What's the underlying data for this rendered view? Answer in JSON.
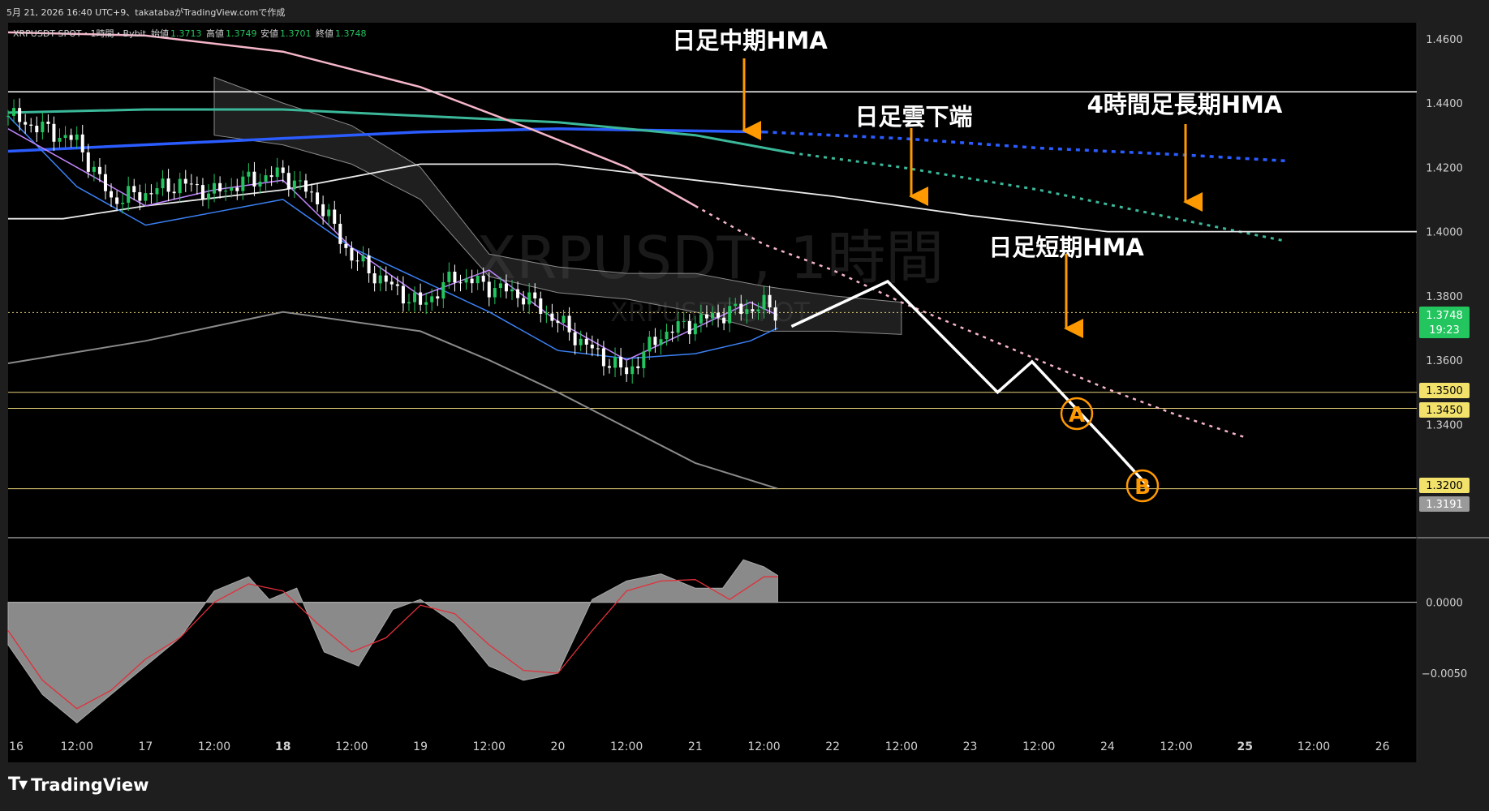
{
  "header": {
    "caption": "5月 21, 2026 16:40 UTC+9、takatabaがTradingView.comで作成",
    "symbol_line": "XRPUSDT SPOT・1時間・Bybit",
    "ohlc": [
      {
        "label": "始値",
        "value": "1.3713"
      },
      {
        "label": "高値",
        "value": "1.3749"
      },
      {
        "label": "安値",
        "value": "1.3701"
      },
      {
        "label": "終値",
        "value": "1.3748"
      }
    ]
  },
  "watermark": {
    "main": "XRPUSDT, 1時間",
    "sub": "XRPUSDT SPOT"
  },
  "annotations": {
    "daily_mid_hma": "日足中期HMA",
    "daily_cloud_lower": "日足雲下端",
    "h4_long_hma": "4時間足長期HMA",
    "daily_short_hma": "日足短期HMA",
    "point_a": "A",
    "point_b": "B"
  },
  "price_labels": {
    "current_price": "1.3748",
    "countdown": "19:23",
    "level_1": "1.3500",
    "level_2": "1.3450",
    "level_3": "1.3200",
    "level_4": "1.3191"
  },
  "footer": {
    "brand": "TradingView"
  },
  "colors": {
    "background": "#000000",
    "panel": "#1e1e1e",
    "up_candle": "#22c55e",
    "down_candle": "#ffffff",
    "mid_hma": "#2a5cff",
    "teal_ma": "#3bb89a",
    "pink_ma": "#f4b5c8",
    "level_line": "#e8d27a",
    "current_price_bg": "#22c55e",
    "arrow": "#ff9900",
    "osc_fill": "#8a8a8a",
    "signal": "#e0303a"
  },
  "chart_data": [
    {
      "type": "line",
      "title": "XRPUSDT SPOT・1時間・Bybit",
      "xlabel": "",
      "ylabel": "",
      "x_ticks": [
        "16",
        "12:00",
        "17",
        "12:00",
        "18",
        "12:00",
        "19",
        "12:00",
        "20",
        "12:00",
        "21",
        "12:00",
        "22",
        "12:00",
        "23",
        "12:00",
        "24",
        "12:00",
        "25",
        "12:00",
        "26"
      ],
      "x_tick_days": [
        16,
        16.5,
        17,
        17.5,
        18,
        18.5,
        19,
        19.5,
        20,
        20.5,
        21,
        21.5,
        22,
        22.5,
        23,
        23.5,
        24,
        24.5,
        25,
        25.5,
        26
      ],
      "xlim": [
        16,
        26.25
      ],
      "y_ticks": [
        "1.4600",
        "1.4400",
        "1.4200",
        "1.4000",
        "1.3800",
        "1.3600",
        "1.3400"
      ],
      "ylim": [
        1.305,
        1.465
      ],
      "horizontal_levels": [
        1.35,
        1.345,
        1.32
      ],
      "current_price": 1.3748,
      "candles": {
        "x": [
          16.0,
          16.25,
          16.5,
          16.75,
          17.0,
          17.25,
          17.5,
          17.75,
          18.0,
          18.25,
          18.5,
          18.75,
          19.0,
          19.25,
          19.5,
          19.75,
          20.0,
          20.25,
          20.5,
          20.75,
          21.0,
          21.25,
          21.5,
          21.6
        ],
        "close": [
          1.436,
          1.432,
          1.428,
          1.41,
          1.412,
          1.415,
          1.412,
          1.416,
          1.418,
          1.41,
          1.392,
          1.384,
          1.377,
          1.386,
          1.383,
          1.38,
          1.372,
          1.363,
          1.356,
          1.368,
          1.372,
          1.375,
          1.377,
          1.3748
        ]
      },
      "series": [
        {
          "name": "",
          "x": [
            16.0,
            17.5,
            19.0,
            20.0,
            21.5,
            22.5,
            23.5,
            24.5,
            25.3
          ],
          "y": [
            1.425,
            1.428,
            1.431,
            1.432,
            1.431,
            1.429,
            1.426,
            1.424,
            1.422
          ]
        },
        {
          "name": "",
          "x": [
            16.0,
            17.0,
            18.0,
            19.0,
            20.0,
            21.0,
            21.7,
            22.5,
            23.5,
            24.5,
            25.3
          ],
          "y": [
            1.437,
            1.438,
            1.438,
            1.436,
            1.434,
            1.43,
            1.4245,
            1.42,
            1.413,
            1.404,
            1.397
          ]
        },
        {
          "name": "",
          "x": [
            16.0,
            17.0,
            18.0,
            19.0,
            19.8,
            20.5,
            21.0,
            21.5,
            22.0,
            22.5,
            23.0,
            23.5,
            24.0,
            24.5,
            25.0
          ],
          "y": [
            1.462,
            1.461,
            1.456,
            1.445,
            1.432,
            1.42,
            1.408,
            1.396,
            1.388,
            1.378,
            1.369,
            1.36,
            1.351,
            1.343,
            1.336
          ]
        },
        {
          "name": "",
          "x": [
            16.0,
            26.25
          ],
          "y": [
            1.4435,
            1.4435
          ]
        },
        {
          "name": "",
          "x": [
            16.0,
            16.4,
            17.0,
            18.0,
            19.0,
            20.0,
            21.0,
            22.0,
            23.0,
            24.0,
            25.0,
            26.25
          ],
          "y": [
            1.404,
            1.404,
            1.408,
            1.413,
            1.421,
            1.421,
            1.416,
            1.411,
            1.405,
            1.4,
            1.4,
            1.4
          ]
        },
        {
          "name": "",
          "x": [
            16.0,
            17.0,
            18.0,
            19.0,
            19.5,
            20.0,
            20.5,
            21.0,
            21.6
          ],
          "y": [
            1.359,
            1.366,
            1.375,
            1.369,
            1.36,
            1.35,
            1.339,
            1.328,
            1.32
          ]
        },
        {
          "name": "",
          "x": [
            16.0,
            16.5,
            17.0,
            17.5,
            18.0,
            18.5,
            19.0,
            19.5,
            20.0,
            20.5,
            21.0,
            21.4,
            21.6
          ],
          "y": [
            1.436,
            1.414,
            1.402,
            1.406,
            1.41,
            1.395,
            1.385,
            1.375,
            1.363,
            1.3605,
            1.362,
            1.366,
            1.37
          ]
        },
        {
          "name": "",
          "x": [
            16.0,
            16.5,
            17.0,
            17.5,
            18.0,
            18.5,
            19.0,
            19.5,
            20.0,
            20.5,
            21.0,
            21.4,
            21.6
          ],
          "y": [
            1.432,
            1.42,
            1.408,
            1.413,
            1.416,
            1.395,
            1.38,
            1.388,
            1.372,
            1.36,
            1.37,
            1.378,
            1.374
          ]
        }
      ],
      "cloud": {
        "x": [
          17.5,
          18.0,
          18.5,
          19.0,
          19.5,
          20.0,
          20.5,
          21.0,
          21.5,
          22.0,
          22.5
        ],
        "upper": [
          1.448,
          1.44,
          1.433,
          1.42,
          1.393,
          1.389,
          1.387,
          1.387,
          1.383,
          1.38,
          1.378
        ],
        "lower": [
          1.43,
          1.427,
          1.421,
          1.41,
          1.386,
          1.381,
          1.379,
          1.375,
          1.369,
          1.369,
          1.368
        ]
      },
      "projection": {
        "x": [
          21.7,
          22.4,
          23.2,
          23.45,
          24.0,
          24.3
        ],
        "y": [
          1.3705,
          1.3845,
          1.35,
          1.3595,
          1.3345,
          1.3205
        ]
      }
    },
    {
      "type": "area",
      "title": "",
      "y_ticks": [
        "0.0000",
        "−0.0050"
      ],
      "ylim": [
        -0.009,
        0.0045
      ],
      "series": [
        {
          "name": "",
          "x": [
            16.0,
            16.25,
            16.5,
            16.75,
            17.0,
            17.25,
            17.5,
            17.75,
            17.9,
            18.1,
            18.3,
            18.55,
            18.8,
            19.0,
            19.25,
            19.5,
            19.75,
            20.0,
            20.25,
            20.5,
            20.75,
            21.0,
            21.2,
            21.35,
            21.5,
            21.6
          ],
          "y": [
            -0.003,
            -0.0065,
            -0.0085,
            -0.0065,
            -0.0045,
            -0.0025,
            0.0008,
            0.0018,
            0.0002,
            0.001,
            -0.0035,
            -0.0045,
            -0.0005,
            0.0002,
            -0.0015,
            -0.0045,
            -0.0055,
            -0.005,
            0.0002,
            0.0015,
            0.002,
            0.001,
            0.001,
            0.003,
            0.0025,
            0.0019
          ]
        },
        {
          "name": "",
          "x": [
            16.0,
            16.25,
            16.5,
            16.75,
            17.0,
            17.25,
            17.5,
            17.75,
            18.0,
            18.25,
            18.5,
            18.75,
            19.0,
            19.25,
            19.5,
            19.75,
            20.0,
            20.25,
            20.5,
            20.75,
            21.0,
            21.25,
            21.5,
            21.6
          ],
          "y": [
            -0.002,
            -0.0055,
            -0.0075,
            -0.0062,
            -0.004,
            -0.0025,
            0.0,
            0.0013,
            0.0008,
            -0.0015,
            -0.0035,
            -0.0025,
            -0.0002,
            -0.0008,
            -0.003,
            -0.0048,
            -0.005,
            -0.002,
            0.0008,
            0.0015,
            0.0016,
            0.0002,
            0.0018,
            0.0018
          ]
        }
      ]
    }
  ]
}
